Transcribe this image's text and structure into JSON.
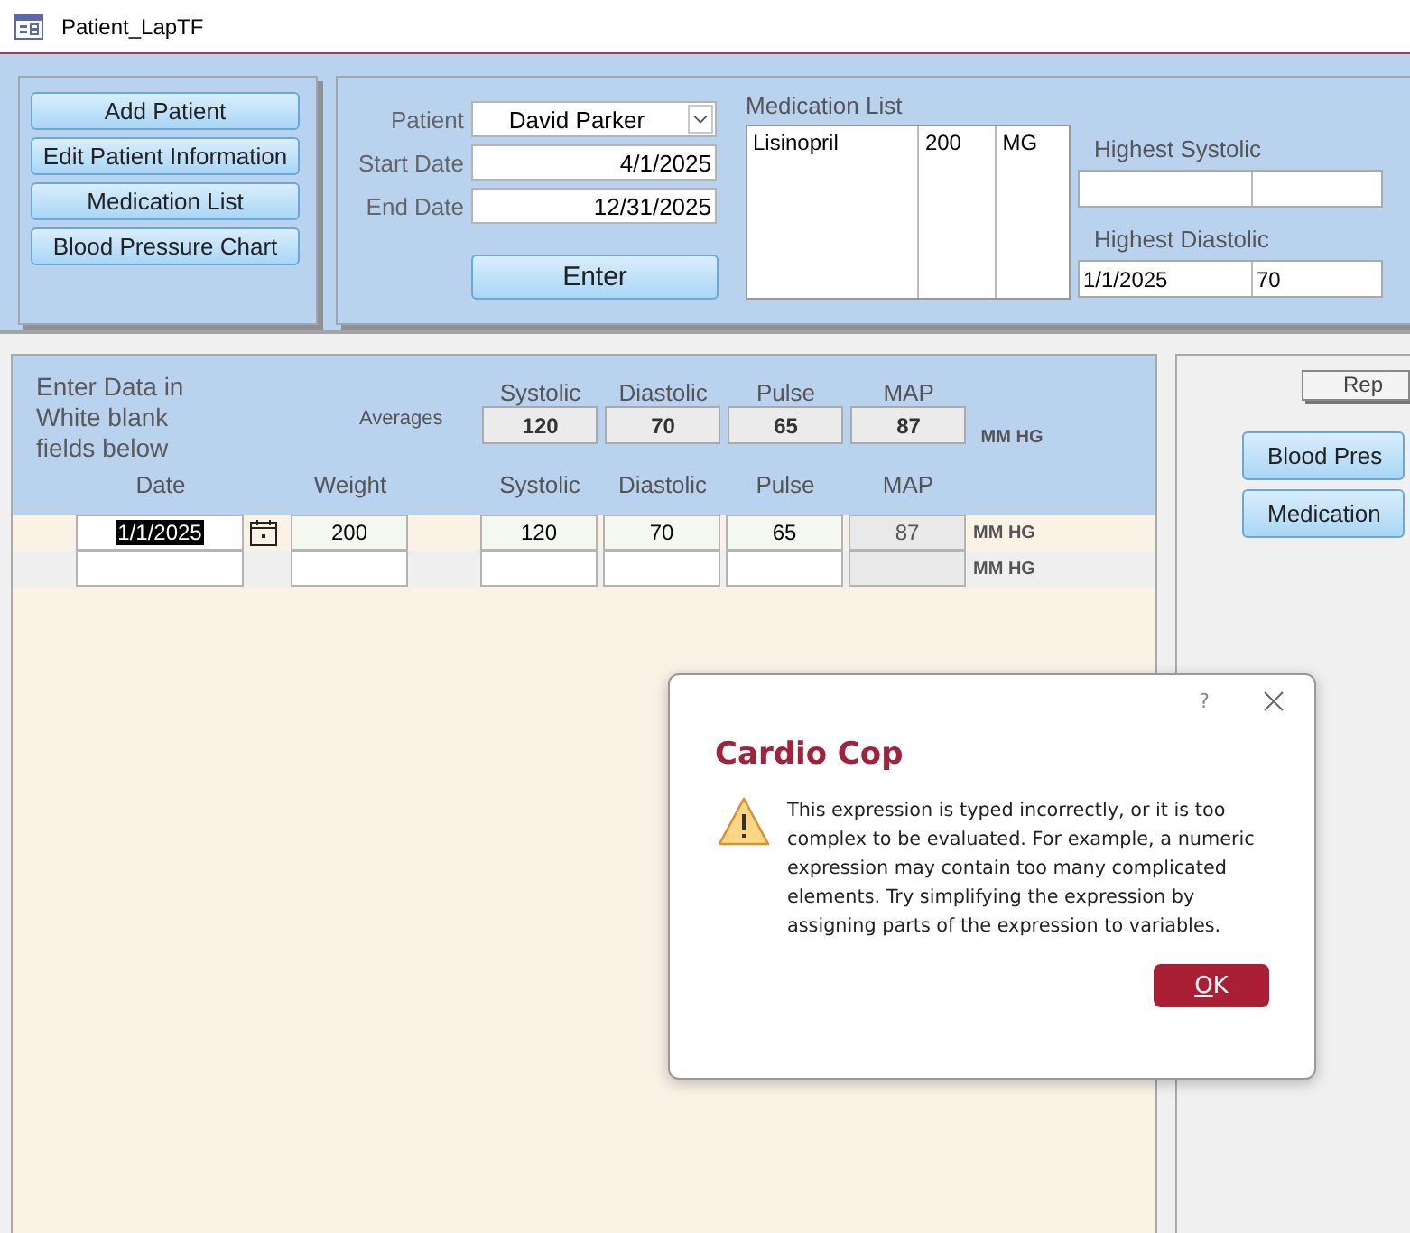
{
  "window": {
    "title": "Patient_LapTF"
  },
  "nav_buttons": [
    "Add Patient",
    "Edit Patient Information",
    "Medication List",
    "Blood Pressure Chart"
  ],
  "filter": {
    "patient_label": "Patient",
    "patient": "David Parker",
    "start_label": "Start Date",
    "start_date": "4/1/2025",
    "end_label": "End Date",
    "end_date": "12/31/2025",
    "enter_button": "Enter"
  },
  "medication_list": {
    "label": "Medication List",
    "rows": [
      [
        "Lisinopril",
        "200",
        "MG"
      ]
    ]
  },
  "highest_systolic": {
    "label": "Highest Systolic"
  },
  "highest_diastolic": {
    "label": "Highest Diastolic",
    "date": "1/1/2025",
    "value": "70"
  },
  "entry": {
    "instructions": "Enter Data in White blank fields below",
    "averages_label": "Averages",
    "average_columns": [
      "Systolic",
      "Diastolic",
      "Pulse",
      "MAP"
    ],
    "averages": [
      "120",
      "70",
      "65",
      "87"
    ],
    "averages_unit": "MM HG",
    "columns": [
      "Date",
      "Weight",
      "Systolic",
      "Diastolic",
      "Pulse",
      "MAP"
    ],
    "rows": [
      {
        "kind": "record",
        "date": "1/1/2025",
        "weight": "200",
        "systolic": "120",
        "diastolic": "70",
        "pulse": "65",
        "map": "87",
        "unit": "MM HG",
        "selected": true
      },
      {
        "kind": "new",
        "unit": "MM HG",
        "selected": false
      }
    ]
  },
  "reports_panel": {
    "heading": "Rep",
    "buttons": [
      "Blood Pres",
      "Medication"
    ]
  },
  "dialog": {
    "help": "?",
    "title": "Cardio Cop",
    "message": "This expression is typed incorrectly, or it is too complex to be evaluated. For example, a numeric expression may contain too many complicated elements. Try simplifying the expression by assigning parts of the expression to variables.",
    "ok_button": "OK"
  }
}
